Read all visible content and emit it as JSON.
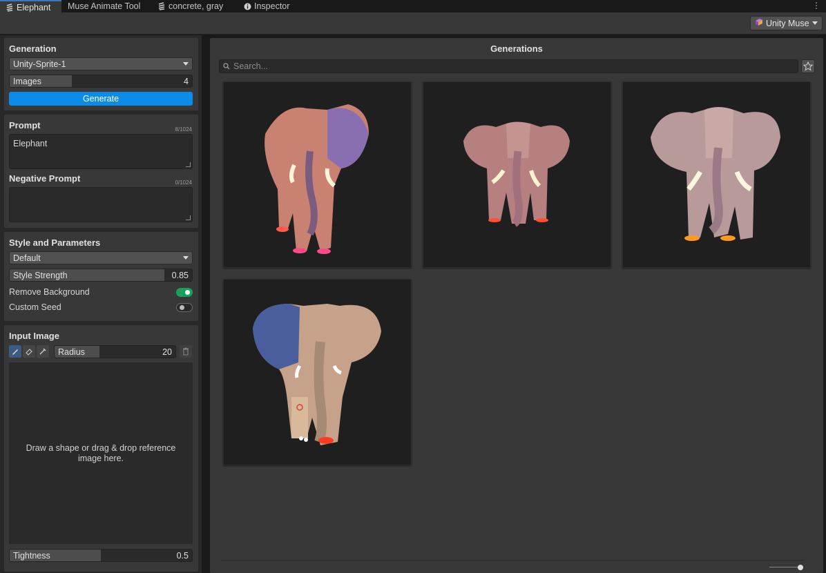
{
  "tabs": [
    {
      "label": "Elephant",
      "icon": "unity-muse-icon",
      "active": true
    },
    {
      "label": "Muse Animate Tool",
      "icon": "",
      "active": false
    },
    {
      "label": "concrete, gray",
      "icon": "unity-muse-icon",
      "active": false
    },
    {
      "label": "Inspector",
      "icon": "info-icon",
      "active": false
    }
  ],
  "toolbar": {
    "account_label": "Unity Muse"
  },
  "generation": {
    "title": "Generation",
    "model": "Unity-Sprite-1",
    "images_label": "Images",
    "images_value": "4",
    "images_fill": 0.34,
    "generate_label": "Generate"
  },
  "prompt": {
    "title": "Prompt",
    "counter": "8/1024",
    "value": "Elephant",
    "negative_title": "Negative Prompt",
    "negative_counter": "0/1024",
    "negative_value": ""
  },
  "style": {
    "title": "Style and Parameters",
    "style_value": "Default",
    "strength_label": "Style Strength",
    "strength_value": "0.85",
    "strength_fill": 0.85,
    "remove_bg_label": "Remove Background",
    "remove_bg_on": true,
    "custom_seed_label": "Custom Seed",
    "custom_seed_on": false
  },
  "input_image": {
    "title": "Input Image",
    "radius_label": "Radius",
    "radius_value": "20",
    "radius_fill": 0.37,
    "drop_hint": "Draw a shape or drag & drop reference image here.",
    "tightness_label": "Tightness",
    "tightness_value": "0.5",
    "tightness_fill": 0.5
  },
  "generations": {
    "title": "Generations",
    "search_placeholder": "Search...",
    "items": [
      {
        "label": "Elephant"
      },
      {
        "label": "Elephant"
      },
      {
        "label": "Elephant"
      },
      {
        "label": "Elephant"
      }
    ]
  },
  "colors": {
    "accent": "#0c8ce9",
    "toggle_on": "#1aa05a",
    "panel_bg": "#383838",
    "window_bg": "#282828"
  }
}
